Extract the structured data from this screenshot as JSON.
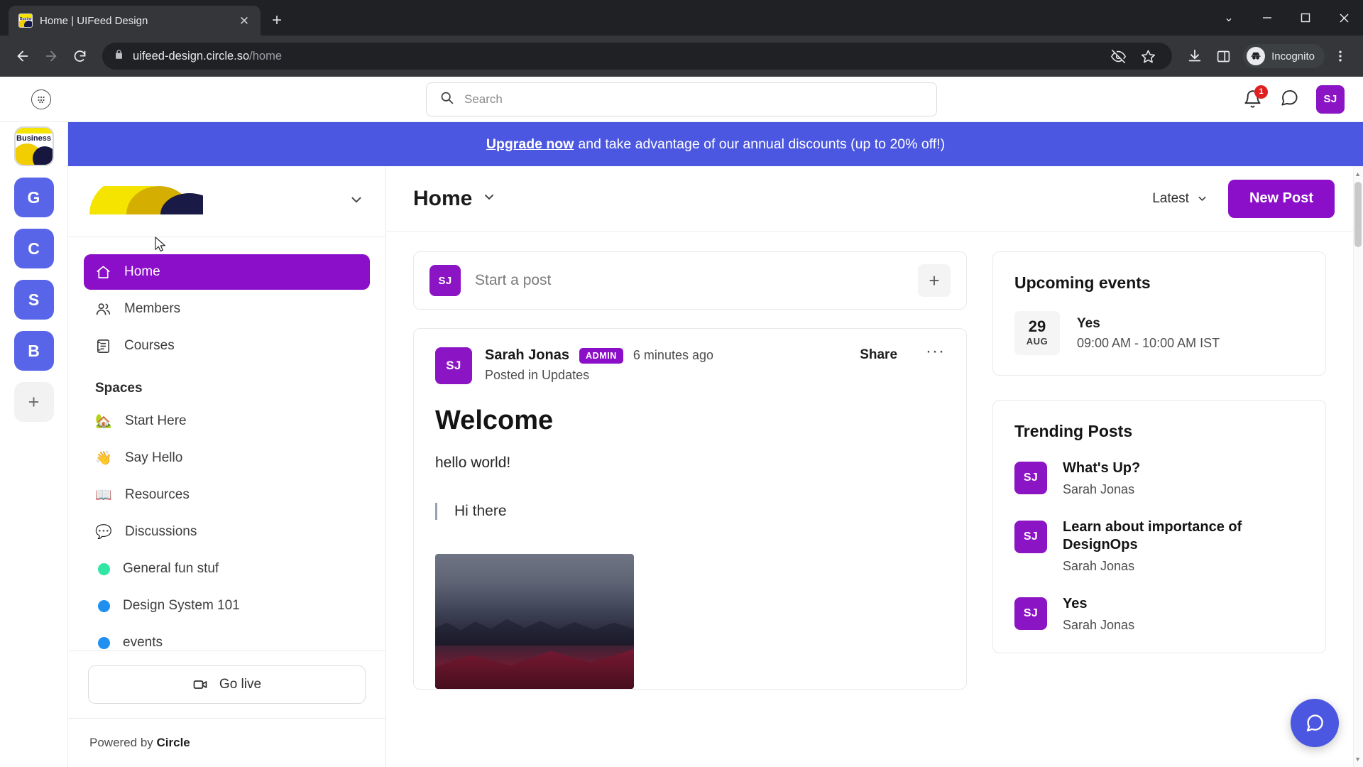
{
  "browser": {
    "tab_title": "Home | UIFeed Design",
    "tab_close": "✕",
    "new_tab": "+",
    "url_host": "uifeed-design.circle.so",
    "url_path": "/home",
    "profile_label": "Incognito",
    "window_minimize": "—",
    "window_maximize": "▢",
    "window_close": "✕",
    "window_chevron": "⌄"
  },
  "app_header": {
    "search_placeholder": "Search",
    "notification_count": "1",
    "avatar_initials": "SJ"
  },
  "banner": {
    "link": "Upgrade now",
    "text": "and take advantage of our annual discounts (up to 20% off!)",
    "bg": "#4b57e0"
  },
  "rail": {
    "items": [
      {
        "label": "Business",
        "type": "business"
      },
      {
        "label": "G",
        "type": "letter"
      },
      {
        "label": "C",
        "type": "letter"
      },
      {
        "label": "S",
        "type": "letter"
      },
      {
        "label": "B",
        "type": "letter"
      },
      {
        "label": "+",
        "type": "add"
      }
    ]
  },
  "sidebar": {
    "nav": [
      {
        "label": "Home",
        "icon": "home-icon",
        "active": true
      },
      {
        "label": "Members",
        "icon": "members-icon",
        "active": false
      },
      {
        "label": "Courses",
        "icon": "courses-icon",
        "active": false
      }
    ],
    "spaces_title": "Spaces",
    "spaces": [
      {
        "label": "Start Here",
        "emoji": "🏡"
      },
      {
        "label": "Say Hello",
        "emoji": "👋"
      },
      {
        "label": "Resources",
        "emoji": "📖"
      },
      {
        "label": "Discussions",
        "emoji": "💬"
      },
      {
        "label": "General fun stuf",
        "dot": "#2fe6a5"
      },
      {
        "label": "Design System 101",
        "dot": "#1f8ff0"
      },
      {
        "label": "events",
        "dot": "#1f8ff0"
      }
    ],
    "go_live": "Go live",
    "powered_prefix": "Powered by ",
    "powered_brand": "Circle"
  },
  "main": {
    "page_title": "Home",
    "sort_label": "Latest",
    "new_post": "New Post",
    "composer_placeholder": "Start a post",
    "composer_avatar": "SJ",
    "composer_plus": "+"
  },
  "post": {
    "avatar": "SJ",
    "author": "Sarah Jonas",
    "badge": "ADMIN",
    "timestamp": "6 minutes ago",
    "posted_in": "Posted in Updates",
    "share": "Share",
    "more": "···",
    "title": "Welcome",
    "body": "hello world!",
    "quote": "Hi there"
  },
  "events": {
    "title": "Upcoming events",
    "items": [
      {
        "day": "29",
        "month": "AUG",
        "name": "Yes",
        "time": "09:00 AM - 10:00 AM IST"
      }
    ]
  },
  "trending": {
    "title": "Trending Posts",
    "items": [
      {
        "avatar": "SJ",
        "title": "What's Up?",
        "author": "Sarah Jonas"
      },
      {
        "avatar": "SJ",
        "title": "Learn about importance of DesignOps",
        "author": "Sarah Jonas"
      },
      {
        "avatar": "SJ",
        "title": "Yes",
        "author": "Sarah Jonas"
      }
    ]
  },
  "colors": {
    "brand_purple": "#8b0fc9",
    "banner_blue": "#4b57e0",
    "rail_blue": "#5865e8",
    "badge_red": "#e02020"
  }
}
